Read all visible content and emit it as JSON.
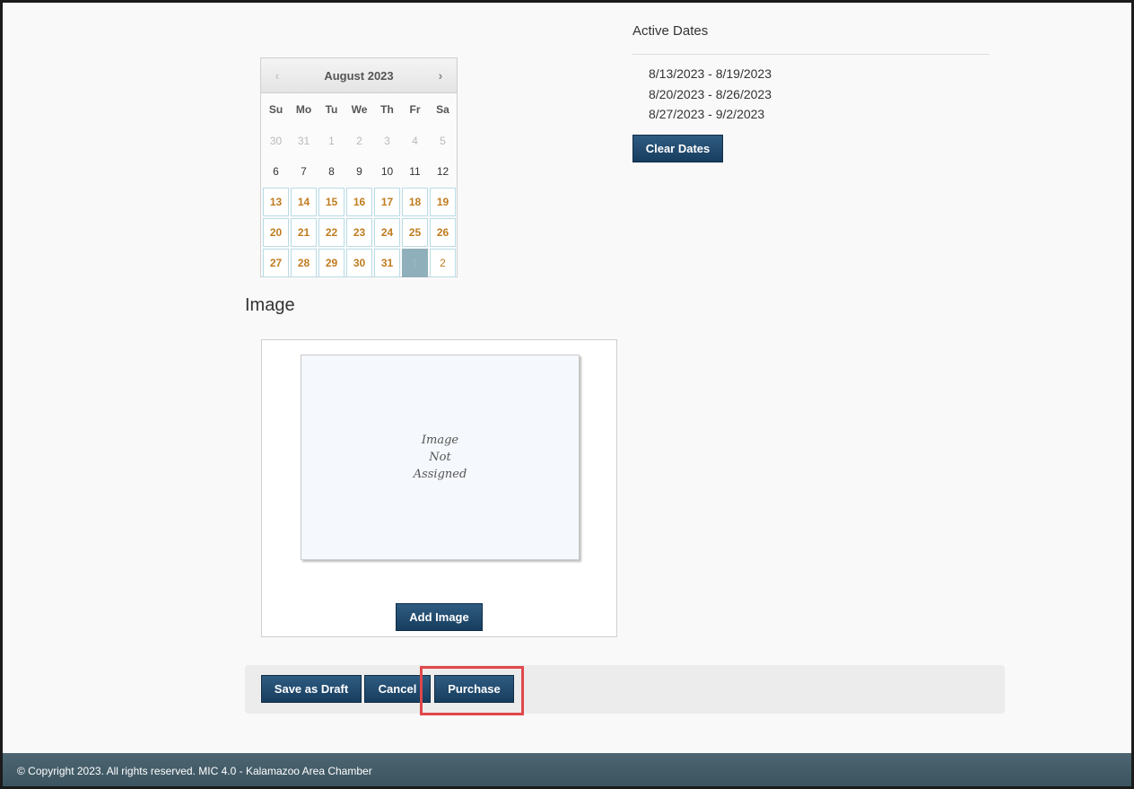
{
  "calendar": {
    "title": "August 2023",
    "prev_icon": "‹",
    "next_icon": "›",
    "weekdays": [
      "Su",
      "Mo",
      "Tu",
      "We",
      "Th",
      "Fr",
      "Sa"
    ],
    "weeks": [
      [
        {
          "d": "30",
          "s": "muted"
        },
        {
          "d": "31",
          "s": "muted"
        },
        {
          "d": "1",
          "s": "muted"
        },
        {
          "d": "2",
          "s": "muted"
        },
        {
          "d": "3",
          "s": "muted"
        },
        {
          "d": "4",
          "s": "muted"
        },
        {
          "d": "5",
          "s": "muted"
        }
      ],
      [
        {
          "d": "6",
          "s": "plain"
        },
        {
          "d": "7",
          "s": "plain"
        },
        {
          "d": "8",
          "s": "plain"
        },
        {
          "d": "9",
          "s": "plain"
        },
        {
          "d": "10",
          "s": "plain"
        },
        {
          "d": "11",
          "s": "plain"
        },
        {
          "d": "12",
          "s": "plain"
        }
      ],
      [
        {
          "d": "13",
          "s": "active"
        },
        {
          "d": "14",
          "s": "active"
        },
        {
          "d": "15",
          "s": "active"
        },
        {
          "d": "16",
          "s": "active"
        },
        {
          "d": "17",
          "s": "active"
        },
        {
          "d": "18",
          "s": "active"
        },
        {
          "d": "19",
          "s": "active"
        }
      ],
      [
        {
          "d": "20",
          "s": "active"
        },
        {
          "d": "21",
          "s": "active"
        },
        {
          "d": "22",
          "s": "active"
        },
        {
          "d": "23",
          "s": "active"
        },
        {
          "d": "24",
          "s": "active"
        },
        {
          "d": "25",
          "s": "active"
        },
        {
          "d": "26",
          "s": "active"
        }
      ],
      [
        {
          "d": "27",
          "s": "active"
        },
        {
          "d": "28",
          "s": "active"
        },
        {
          "d": "29",
          "s": "active"
        },
        {
          "d": "30",
          "s": "active"
        },
        {
          "d": "31",
          "s": "active"
        },
        {
          "d": "1",
          "s": "selected"
        },
        {
          "d": "2",
          "s": "active next"
        }
      ]
    ]
  },
  "active_dates": {
    "title": "Active Dates",
    "ranges": [
      "8/13/2023 - 8/19/2023",
      "8/20/2023 - 8/26/2023",
      "8/27/2023 - 9/2/2023"
    ],
    "clear_label": "Clear Dates"
  },
  "image_section": {
    "title": "Image",
    "placeholder_lines": [
      "Image",
      "Not",
      "Assigned"
    ],
    "add_label": "Add Image"
  },
  "actions": {
    "save_draft_label": "Save as Draft",
    "cancel_label": "Cancel",
    "purchase_label": "Purchase"
  },
  "footer": {
    "text": "© Copyright 2023. All rights reserved. MIC 4.0 - Kalamazoo Area Chamber"
  },
  "colors": {
    "button": "#1f4a6f",
    "active_day": "#c07c1f",
    "highlight": "#e0484b",
    "footer": "#44606c"
  }
}
